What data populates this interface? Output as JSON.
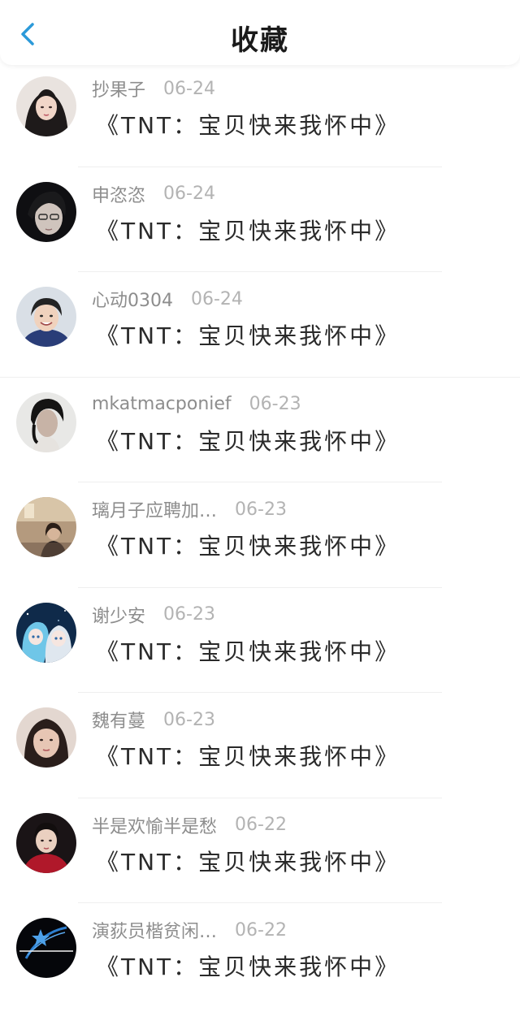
{
  "header": {
    "title": "收藏",
    "back_icon": "chevron-left-icon",
    "accent_color": "#2c9ad9"
  },
  "items": [
    {
      "username": "抄果子",
      "date": "06-24",
      "story": "《TNT：宝贝快来我怀中》",
      "avatar": "avatar-photo"
    },
    {
      "username": "申恣恣",
      "date": "06-24",
      "story": "《TNT：宝贝快来我怀中》",
      "avatar": "avatar-photo"
    },
    {
      "username": "心动0304",
      "date": "06-24",
      "story": "《TNT：宝贝快来我怀中》",
      "avatar": "avatar-photo"
    },
    {
      "username": "mkatmacponief",
      "date": "06-23",
      "story": "《TNT：宝贝快来我怀中》",
      "avatar": "avatar-photo"
    },
    {
      "username": "璃月子应聘加…",
      "date": "06-23",
      "story": "《TNT：宝贝快来我怀中》",
      "avatar": "avatar-photo"
    },
    {
      "username": "谢少安",
      "date": "06-23",
      "story": "《TNT：宝贝快来我怀中》",
      "avatar": "avatar-illustration"
    },
    {
      "username": "魏有蔓",
      "date": "06-23",
      "story": "《TNT：宝贝快来我怀中》",
      "avatar": "avatar-photo"
    },
    {
      "username": "半是欢愉半是愁",
      "date": "06-22",
      "story": "《TNT：宝贝快来我怀中》",
      "avatar": "avatar-photo"
    },
    {
      "username": "演荻员楷贫闲…",
      "date": "06-22",
      "story": "《TNT：宝贝快来我怀中》",
      "avatar": "avatar-logo"
    }
  ]
}
